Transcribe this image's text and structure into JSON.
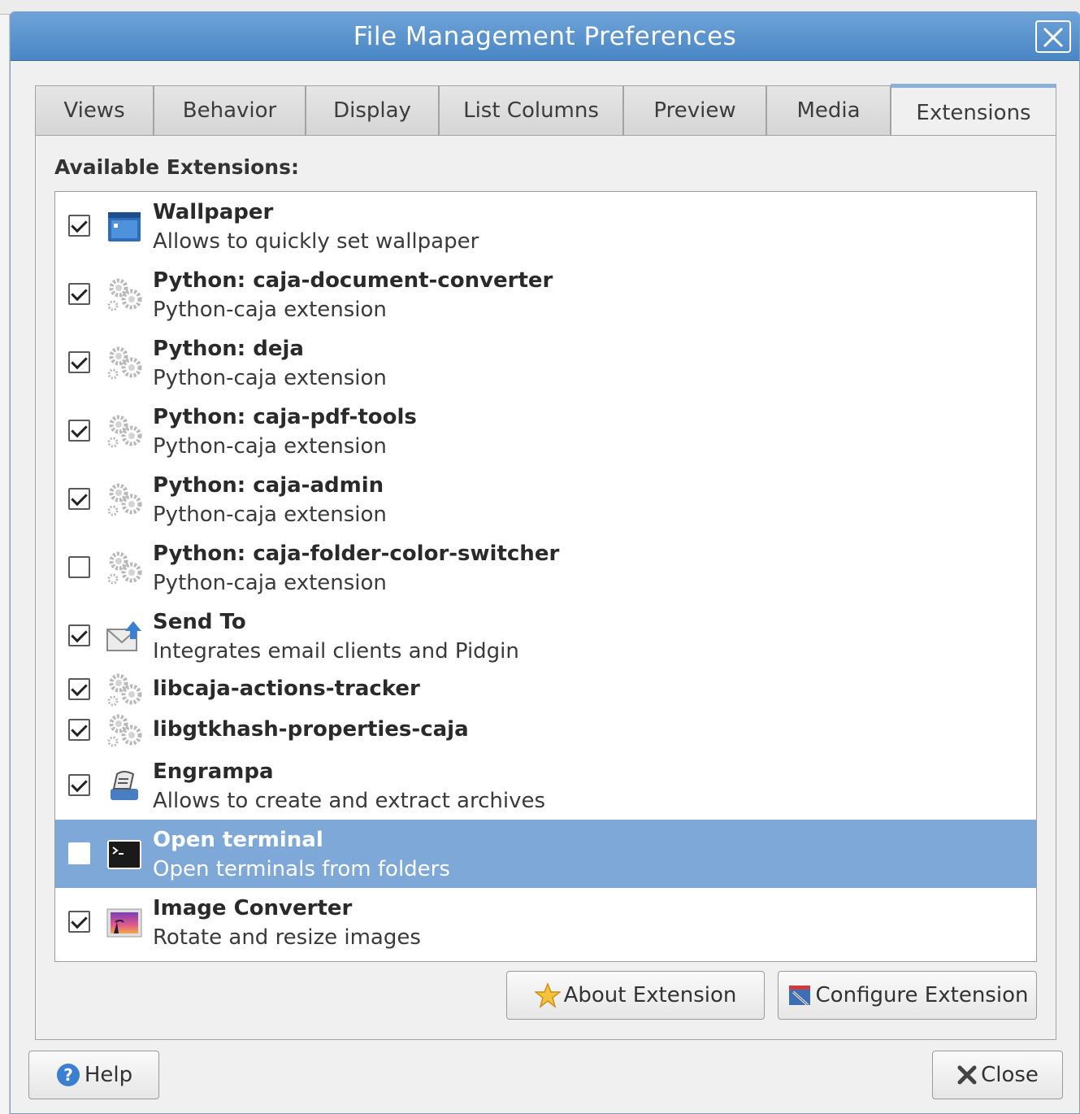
{
  "window": {
    "title": "File Management Preferences"
  },
  "tabs": [
    {
      "label": "Views"
    },
    {
      "label": "Behavior"
    },
    {
      "label": "Display"
    },
    {
      "label": "List Columns"
    },
    {
      "label": "Preview"
    },
    {
      "label": "Media"
    },
    {
      "label": "Extensions",
      "active": true
    }
  ],
  "extensions": {
    "section_label": "Available Extensions:",
    "items": [
      {
        "name": "Wallpaper",
        "description": "Allows to quickly set wallpaper",
        "checked": true,
        "icon": "wallpaper-icon"
      },
      {
        "name": "Python: caja-document-converter",
        "description": "Python-caja extension",
        "checked": true,
        "icon": "gears-icon"
      },
      {
        "name": "Python: deja",
        "description": "Python-caja extension",
        "checked": true,
        "icon": "gears-icon"
      },
      {
        "name": "Python: caja-pdf-tools",
        "description": "Python-caja extension",
        "checked": true,
        "icon": "gears-icon"
      },
      {
        "name": "Python: caja-admin",
        "description": "Python-caja extension",
        "checked": true,
        "icon": "gears-icon"
      },
      {
        "name": "Python: caja-folder-color-switcher",
        "description": "Python-caja extension",
        "checked": false,
        "icon": "gears-icon"
      },
      {
        "name": "Send To",
        "description": "Integrates email clients and Pidgin",
        "checked": true,
        "icon": "send-to-icon"
      },
      {
        "name": "libcaja-actions-tracker",
        "description": "",
        "checked": true,
        "icon": "gears-icon"
      },
      {
        "name": "libgtkhash-properties-caja",
        "description": "",
        "checked": true,
        "icon": "gears-icon"
      },
      {
        "name": "Engrampa",
        "description": "Allows to create and extract archives",
        "checked": true,
        "icon": "archive-icon"
      },
      {
        "name": "Open terminal",
        "description": "Open terminals from folders",
        "checked": false,
        "icon": "terminal-icon",
        "selected": true
      },
      {
        "name": "Image Converter",
        "description": "Rotate and resize images",
        "checked": true,
        "icon": "image-icon"
      }
    ]
  },
  "buttons": {
    "about": "About Extension",
    "configure": "Configure Extension",
    "help": "Help",
    "close": "Close"
  },
  "colors": {
    "titlebar": "#4a86c4",
    "selection": "#7ea8d8"
  }
}
